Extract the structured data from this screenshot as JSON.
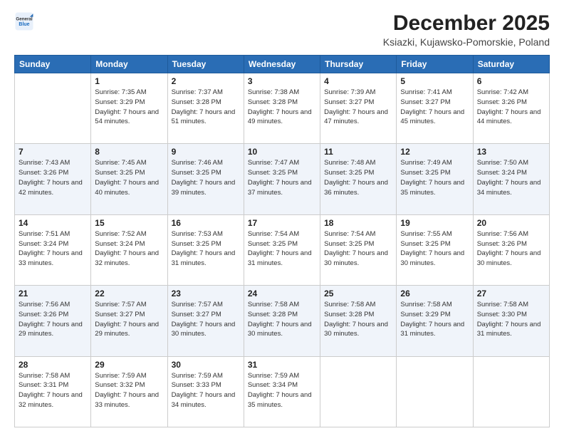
{
  "header": {
    "logo": {
      "line1": "General",
      "line2": "Blue"
    },
    "title": "December 2025",
    "location": "Ksiazki, Kujawsko-Pomorskie, Poland"
  },
  "weekdays": [
    "Sunday",
    "Monday",
    "Tuesday",
    "Wednesday",
    "Thursday",
    "Friday",
    "Saturday"
  ],
  "weeks": [
    {
      "shaded": false,
      "days": [
        null,
        {
          "num": "1",
          "sunrise": "7:35 AM",
          "sunset": "3:29 PM",
          "daylight": "7 hours and 54 minutes."
        },
        {
          "num": "2",
          "sunrise": "7:37 AM",
          "sunset": "3:28 PM",
          "daylight": "7 hours and 51 minutes."
        },
        {
          "num": "3",
          "sunrise": "7:38 AM",
          "sunset": "3:28 PM",
          "daylight": "7 hours and 49 minutes."
        },
        {
          "num": "4",
          "sunrise": "7:39 AM",
          "sunset": "3:27 PM",
          "daylight": "7 hours and 47 minutes."
        },
        {
          "num": "5",
          "sunrise": "7:41 AM",
          "sunset": "3:27 PM",
          "daylight": "7 hours and 45 minutes."
        },
        {
          "num": "6",
          "sunrise": "7:42 AM",
          "sunset": "3:26 PM",
          "daylight": "7 hours and 44 minutes."
        }
      ]
    },
    {
      "shaded": true,
      "days": [
        {
          "num": "7",
          "sunrise": "7:43 AM",
          "sunset": "3:26 PM",
          "daylight": "7 hours and 42 minutes."
        },
        {
          "num": "8",
          "sunrise": "7:45 AM",
          "sunset": "3:25 PM",
          "daylight": "7 hours and 40 minutes."
        },
        {
          "num": "9",
          "sunrise": "7:46 AM",
          "sunset": "3:25 PM",
          "daylight": "7 hours and 39 minutes."
        },
        {
          "num": "10",
          "sunrise": "7:47 AM",
          "sunset": "3:25 PM",
          "daylight": "7 hours and 37 minutes."
        },
        {
          "num": "11",
          "sunrise": "7:48 AM",
          "sunset": "3:25 PM",
          "daylight": "7 hours and 36 minutes."
        },
        {
          "num": "12",
          "sunrise": "7:49 AM",
          "sunset": "3:25 PM",
          "daylight": "7 hours and 35 minutes."
        },
        {
          "num": "13",
          "sunrise": "7:50 AM",
          "sunset": "3:24 PM",
          "daylight": "7 hours and 34 minutes."
        }
      ]
    },
    {
      "shaded": false,
      "days": [
        {
          "num": "14",
          "sunrise": "7:51 AM",
          "sunset": "3:24 PM",
          "daylight": "7 hours and 33 minutes."
        },
        {
          "num": "15",
          "sunrise": "7:52 AM",
          "sunset": "3:24 PM",
          "daylight": "7 hours and 32 minutes."
        },
        {
          "num": "16",
          "sunrise": "7:53 AM",
          "sunset": "3:25 PM",
          "daylight": "7 hours and 31 minutes."
        },
        {
          "num": "17",
          "sunrise": "7:54 AM",
          "sunset": "3:25 PM",
          "daylight": "7 hours and 31 minutes."
        },
        {
          "num": "18",
          "sunrise": "7:54 AM",
          "sunset": "3:25 PM",
          "daylight": "7 hours and 30 minutes."
        },
        {
          "num": "19",
          "sunrise": "7:55 AM",
          "sunset": "3:25 PM",
          "daylight": "7 hours and 30 minutes."
        },
        {
          "num": "20",
          "sunrise": "7:56 AM",
          "sunset": "3:26 PM",
          "daylight": "7 hours and 30 minutes."
        }
      ]
    },
    {
      "shaded": true,
      "days": [
        {
          "num": "21",
          "sunrise": "7:56 AM",
          "sunset": "3:26 PM",
          "daylight": "7 hours and 29 minutes."
        },
        {
          "num": "22",
          "sunrise": "7:57 AM",
          "sunset": "3:27 PM",
          "daylight": "7 hours and 29 minutes."
        },
        {
          "num": "23",
          "sunrise": "7:57 AM",
          "sunset": "3:27 PM",
          "daylight": "7 hours and 30 minutes."
        },
        {
          "num": "24",
          "sunrise": "7:58 AM",
          "sunset": "3:28 PM",
          "daylight": "7 hours and 30 minutes."
        },
        {
          "num": "25",
          "sunrise": "7:58 AM",
          "sunset": "3:28 PM",
          "daylight": "7 hours and 30 minutes."
        },
        {
          "num": "26",
          "sunrise": "7:58 AM",
          "sunset": "3:29 PM",
          "daylight": "7 hours and 31 minutes."
        },
        {
          "num": "27",
          "sunrise": "7:58 AM",
          "sunset": "3:30 PM",
          "daylight": "7 hours and 31 minutes."
        }
      ]
    },
    {
      "shaded": false,
      "days": [
        {
          "num": "28",
          "sunrise": "7:58 AM",
          "sunset": "3:31 PM",
          "daylight": "7 hours and 32 minutes."
        },
        {
          "num": "29",
          "sunrise": "7:59 AM",
          "sunset": "3:32 PM",
          "daylight": "7 hours and 33 minutes."
        },
        {
          "num": "30",
          "sunrise": "7:59 AM",
          "sunset": "3:33 PM",
          "daylight": "7 hours and 34 minutes."
        },
        {
          "num": "31",
          "sunrise": "7:59 AM",
          "sunset": "3:34 PM",
          "daylight": "7 hours and 35 minutes."
        },
        null,
        null,
        null
      ]
    }
  ],
  "labels": {
    "sunrise_prefix": "Sunrise: ",
    "sunset_prefix": "Sunset: ",
    "daylight_prefix": "Daylight: "
  }
}
